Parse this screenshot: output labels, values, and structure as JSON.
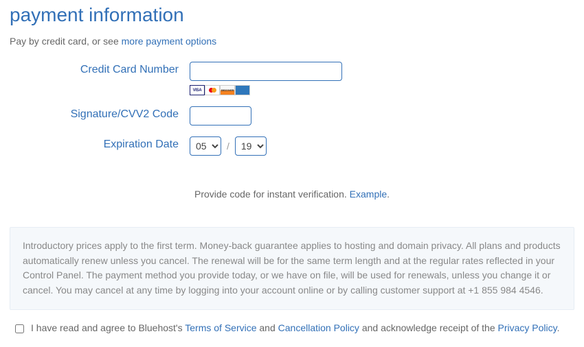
{
  "title": "payment information",
  "pay_by_prefix": "Pay by credit card, or see ",
  "more_payment_options": "more payment options",
  "labels": {
    "cc": "Credit Card Number",
    "cvv": "Signature/CVV2 Code",
    "exp": "Expiration Date"
  },
  "exp": {
    "month": "05",
    "year": "19",
    "sep": "/"
  },
  "verify": {
    "text": "Provide code for instant verification. ",
    "example": "Example"
  },
  "notice": "Introductory prices apply to the first term. Money-back guarantee applies to hosting and domain privacy. All plans and products automatically renew unless you cancel. The renewal will be for the same term length and at the regular rates reflected in your Control Panel. The payment method you provide today, or we have on file, will be used for renewals, unless you change it or cancel. You may cancel at any time by logging into your account online or by calling customer support at +1 855 984 4546.",
  "agree": {
    "prefix": "I have read and agree to Bluehost's ",
    "tos": "Terms of Service",
    "and": " and ",
    "cancel": "Cancellation Policy",
    "ack": " and acknowledge receipt of the ",
    "privacy": "Privacy Policy",
    "period": "."
  },
  "card_icons": {
    "visa": "VISA",
    "discover": "DISCOVER"
  }
}
